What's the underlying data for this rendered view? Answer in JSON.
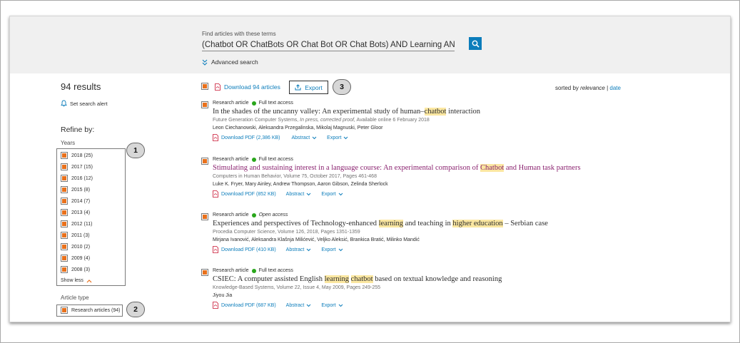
{
  "search": {
    "label": "Find articles with these terms",
    "query": "(Chatbot OR ChatBots OR Chat Bot OR Chat Bots) AND Learning AND (Hig",
    "advanced_label": "Advanced search"
  },
  "sidebar": {
    "results_count": "94 results",
    "alert_label": "Set search alert",
    "refine_label": "Refine by:",
    "years_label": "Years",
    "years": [
      {
        "label": "2018 (25)"
      },
      {
        "label": "2017 (15)"
      },
      {
        "label": "2016 (12)"
      },
      {
        "label": "2015 (8)"
      },
      {
        "label": "2014 (7)"
      },
      {
        "label": "2013 (4)"
      },
      {
        "label": "2012 (11)"
      },
      {
        "label": "2011 (3)"
      },
      {
        "label": "2010 (2)"
      },
      {
        "label": "2009 (4)"
      },
      {
        "label": "2008 (3)"
      }
    ],
    "show_less": "Show less",
    "article_type_label": "Article type",
    "article_type_item": "Research articles (94)"
  },
  "callouts": [
    "1",
    "2",
    "3"
  ],
  "toolbar": {
    "download_all": "Download 94 articles",
    "export": "Export",
    "sorted_by": "sorted by",
    "relevance": "relevance",
    "separator": "|",
    "date": "date"
  },
  "results": [
    {
      "type": "Research article",
      "access": "Full text access",
      "title_parts": [
        "In the shades of the uncanny valley: An experimental study of human–",
        "chatbot",
        " interaction"
      ],
      "source_journal": "Future Generation Computer Systems,",
      "source_rest": " In press, corrected proof,",
      "source_tail": " Available online 6 February 2018",
      "authors": "Leon Ciechanowski, Aleksandra Przegalinska, Mikolaj Magnuski, Peter Gloor",
      "pdf": "Download PDF (2,386 KB)",
      "abstract": "Abstract",
      "export": "Export"
    },
    {
      "type": "Research article",
      "access": "Full text access",
      "title_parts": [
        "Stimulating and sustaining interest in a language course: An experimental comparison of ",
        "Chatbot",
        " and Human task partners"
      ],
      "source": "Computers in Human Behavior, Volume 75, October 2017, Pages 461-468",
      "authors": "Luke K. Fryer, Mary Ainley, Andrew Thompson, Aaron Gibson, Zelinda Sherlock",
      "pdf": "Download PDF (852 KB)",
      "abstract": "Abstract",
      "export": "Export"
    },
    {
      "type": "Research article",
      "access": "Open access",
      "title_parts": [
        "Experiences and perspectives of Technology-enhanced ",
        "learning",
        " and teaching in ",
        "higher education",
        " – Serbian case"
      ],
      "source": "Procedia Computer Science, Volume 126, 2018, Pages 1351-1359",
      "authors": "Mirjana Ivanović, Aleksandra Klašnja Milićević, Veljko Aleksić, Brankica Bratić, Milinko Mandić",
      "pdf": "Download PDF (410 KB)",
      "abstract": "Abstract",
      "export": "Export"
    },
    {
      "type": "Research article",
      "access": "Full text access",
      "title_parts": [
        "CSIEC: A computer assisted English ",
        "learning",
        " ",
        "chatbot",
        " based on textual knowledge and reasoning"
      ],
      "source": "Knowledge-Based Systems, Volume 22, Issue 4, May 2009, Pages 249-255",
      "authors": "Jiyou Jia",
      "pdf": "Download PDF (687 KB)",
      "abstract": "Abstract",
      "export": "Export"
    }
  ],
  "colors": {
    "accent_blue": "#0c7dbb",
    "checkbox_orange": "#e9711c",
    "access_green": "#29a61b",
    "highlight": "#fbe7a1",
    "visited_title": "#8a226f"
  },
  "icons": [
    "search-icon",
    "double-chevron-down-icon",
    "bell-icon",
    "pdf-icon",
    "export-icon",
    "chevron-down-icon",
    "chevron-up-icon"
  ]
}
